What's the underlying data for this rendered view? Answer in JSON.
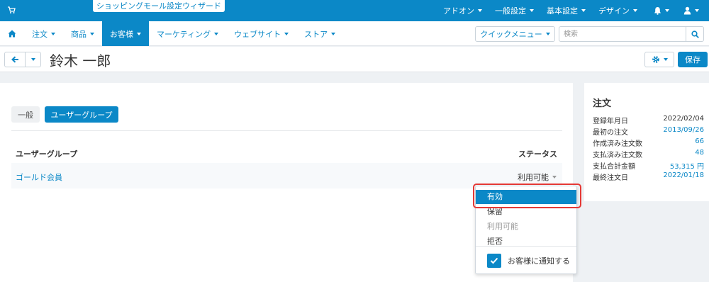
{
  "topbar": {
    "wizard": "ショッピングモール設定ウィザード",
    "links": [
      {
        "label": "アドオン"
      },
      {
        "label": "一般設定"
      },
      {
        "label": "基本設定"
      },
      {
        "label": "デザイン"
      }
    ]
  },
  "nav": {
    "items": [
      {
        "label": "注文"
      },
      {
        "label": "商品"
      },
      {
        "label": "お客様"
      },
      {
        "label": "マーケティング"
      },
      {
        "label": "ウェブサイト"
      },
      {
        "label": "ストア"
      }
    ],
    "quick_menu": "クイックメニュー",
    "search_placeholder": "検索"
  },
  "page": {
    "title": "鈴木 一郎",
    "save_label": "保存"
  },
  "tabs": {
    "general": "一般",
    "user_groups": "ユーザーグループ"
  },
  "table": {
    "headers": {
      "group": "ユーザーグループ",
      "status": "ステータス"
    },
    "rows": [
      {
        "group": "ゴールド会員",
        "status": "利用可能"
      }
    ]
  },
  "dropdown": {
    "options": [
      "有効",
      "保留",
      "利用可能",
      "拒否"
    ],
    "notify_label": "お客様に通知する",
    "notify_checked": true
  },
  "orders_panel": {
    "title": "注文",
    "stats": [
      {
        "label": "登録年月日",
        "value": "2022/02/04"
      },
      {
        "label": "最初の注文",
        "value": "2013/09/26"
      },
      {
        "label": "作成済み注文数",
        "value": "66"
      },
      {
        "label": "支払済み注文数",
        "value": "48"
      },
      {
        "label": "支払合計金額",
        "value": "53,315 円"
      },
      {
        "label": "最終注文日",
        "value": "2022/01/18"
      }
    ]
  },
  "colors": {
    "accent": "#0b88c7",
    "highlight_border": "#e53935"
  }
}
